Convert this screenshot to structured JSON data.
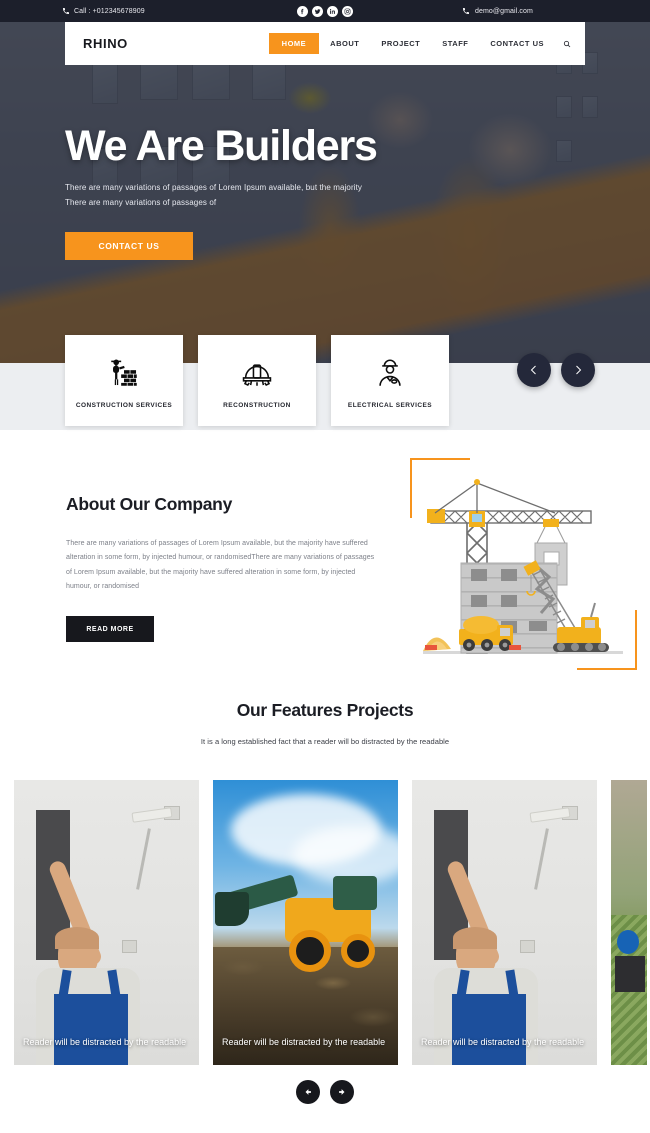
{
  "topbar": {
    "phone_icon": "phone-icon",
    "phone": "Call : +012345678909",
    "email_icon": "phone-icon",
    "email": "demo@gmail.com",
    "social": [
      {
        "name": "facebook-icon",
        "glyph": "f"
      },
      {
        "name": "twitter-icon",
        "glyph": "t"
      },
      {
        "name": "linkedin-icon",
        "glyph": "in"
      },
      {
        "name": "instagram-icon",
        "glyph": "o"
      }
    ],
    "bg_color": "#1c1f2b"
  },
  "navbar": {
    "brand": "RHINO",
    "links": [
      {
        "label": "HOME",
        "active": true
      },
      {
        "label": "ABOUT",
        "active": false
      },
      {
        "label": "PROJECT",
        "active": false
      },
      {
        "label": "STAFF",
        "active": false
      },
      {
        "label": "CONTACT US",
        "active": false
      }
    ],
    "search_icon": "search-icon",
    "accent_color": "#f7941d"
  },
  "hero": {
    "title": "We Are Builders",
    "subtitle_line1": "There are many variations of passages of Lorem Ipsum available, but the majority",
    "subtitle_line2": "There are many variations of passages of",
    "cta_label": "CONTACT US",
    "prev_icon": "chevron-left-icon",
    "next_icon": "chevron-right-icon"
  },
  "services": [
    {
      "label": "CONSTRUCTION SERVICES",
      "icon": "worker-bricks-icon"
    },
    {
      "label": "RECONSTRUCTION",
      "icon": "helmet-gear-icon"
    },
    {
      "label": "ELECTRICAL SERVICES",
      "icon": "worker-portrait-icon"
    }
  ],
  "about": {
    "title": "About Our Company",
    "body": "There are many variations of passages of Lorem Ipsum available, but the majority have suffered alteration in some form, by injected humour, or randomisedThere are many variations of passages of Lorem Ipsum available, but the majority have suffered alteration in some form, by injected humour, or randomised",
    "button_label": "READ MORE",
    "illustration": "construction-site-illustration",
    "corner_color": "#f7941d"
  },
  "features": {
    "title": "Our Features Projects",
    "subtitle": "It is a long established fact that a reader will bo distracted by the readable",
    "cards": [
      {
        "caption": "Reader will be distracted by the readable",
        "image": "painter-roller-photo"
      },
      {
        "caption": "Reader will be distracted by the readable",
        "image": "excavator-sky-photo"
      },
      {
        "caption": "Reader will be distracted by the readable",
        "image": "painter-roller-photo"
      },
      {
        "caption": "",
        "image": "cityscape-photo"
      }
    ],
    "prev_icon": "arrow-left-icon",
    "next_icon": "arrow-right-icon"
  }
}
